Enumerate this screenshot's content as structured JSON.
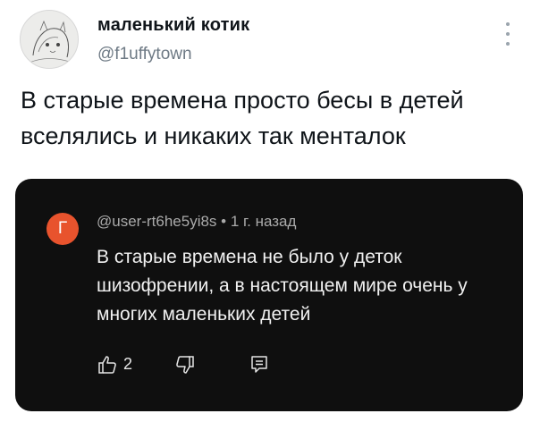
{
  "tweet": {
    "display_name": "маленький котик",
    "handle": "@f1uffytown",
    "text": "В старые времена просто бесы в детей вселялись и никаких так менталок"
  },
  "embedded_comment": {
    "avatar_letter": "Г",
    "avatar_color": "#e8532d",
    "username": "@user-rt6he5yi8s",
    "time": "1 г. назад",
    "text": "В старые времена не было у деток шизофрении, а в настоящем мире очень у многих маленьких детей",
    "like_count": "2",
    "icons": [
      "thumbs-up-icon",
      "thumbs-down-icon",
      "reply-icon"
    ]
  }
}
